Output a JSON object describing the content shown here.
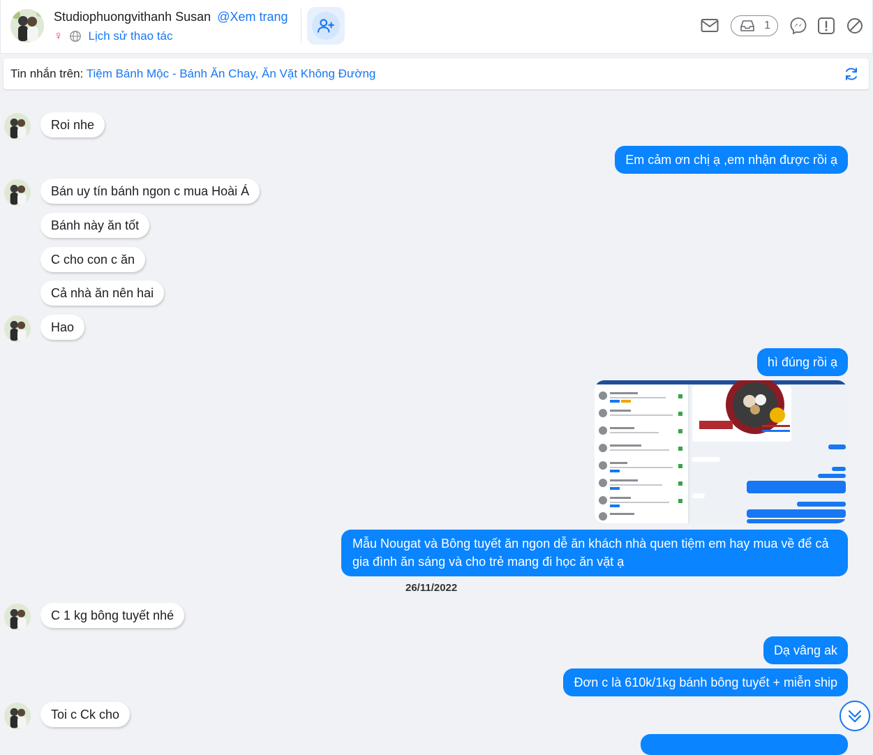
{
  "header": {
    "name": "Studiophuongvithanh Susan",
    "view_page": "@Xem trang",
    "history": "Lịch sử thao tác",
    "inbox_count": "1"
  },
  "info_bar": {
    "label": "Tin nhắn trên:",
    "page_name": "Tiệm Bánh Mộc - Bánh Ăn Chay, Ăn Vặt Không Đường"
  },
  "messages": [
    {
      "dir": "in",
      "text": "Roi nhe"
    },
    {
      "dir": "out",
      "text": "Em cảm ơn chị ạ ,em nhận được rồi ạ"
    },
    {
      "dir": "in",
      "text": "Bán uy tín bánh ngon c mua Hoài Á"
    },
    {
      "dir": "in",
      "text": "Bánh này ăn tốt"
    },
    {
      "dir": "in",
      "text": "C cho con c ăn"
    },
    {
      "dir": "in",
      "text": "Cả nhà ăn nên hai"
    },
    {
      "dir": "in",
      "text": "Hao"
    },
    {
      "dir": "out",
      "text": "hì đúng rồi ạ"
    },
    {
      "dir": "out",
      "text": "Mẫu Nougat và Bông tuyết ăn ngon dễ ăn khách nhà quen tiệm em hay mua về để cả gia đình ăn sáng và cho trẻ mang đi học ăn vặt ạ"
    },
    {
      "dir": "in",
      "text": "C 1 kg bông tuyết nhé"
    },
    {
      "dir": "out",
      "text": "Dạ vâng ak"
    },
    {
      "dir": "out",
      "text": "Đơn c là 610k/1kg bánh bông tuyết + miễn ship"
    },
    {
      "dir": "in",
      "text": "Toi c Ck cho"
    }
  ],
  "date_separator": "26/11/2022",
  "icons": [
    "mail-icon",
    "inbox-icon",
    "messenger-icon",
    "report-icon",
    "block-icon",
    "refresh-icon",
    "add-friend-icon",
    "chevron-double-down-icon",
    "female-icon",
    "globe-icon"
  ],
  "colors": {
    "accent": "#1877f2",
    "bubble_out": "#0a84ff",
    "background": "#f0f2f5"
  }
}
